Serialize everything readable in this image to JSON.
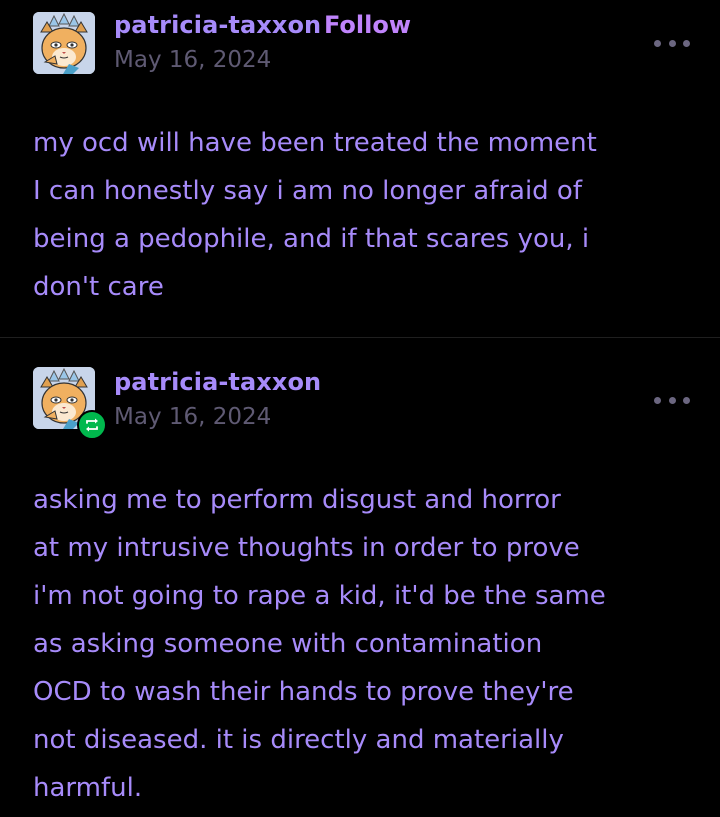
{
  "colors": {
    "background": "#000000",
    "text_purple": "#a78bfa",
    "follow_purple": "#c084fc",
    "date_gray": "#5f5a73",
    "reblog_green": "#00b84d"
  },
  "posts": [
    {
      "username": "patricia-taxxon",
      "follow_label": "Follow",
      "date": "May 16, 2024",
      "more_icon": "ellipsis-icon",
      "body": "my ocd will have been treated the moment\nI can honestly say i am no longer afraid of\nbeing a pedophile, and if that scares you, i\ndon't care"
    },
    {
      "username": "patricia-taxxon",
      "date": "May 16, 2024",
      "badge_icon": "reblog-icon",
      "more_icon": "ellipsis-icon",
      "body": "asking me to perform disgust and horror\nat my intrusive thoughts in order to prove\ni'm not going to rape a kid, it'd be the same\nas asking someone with contamination\nOCD to wash their hands to prove they're\nnot diseased. it is directly and materially\nharmful."
    }
  ]
}
